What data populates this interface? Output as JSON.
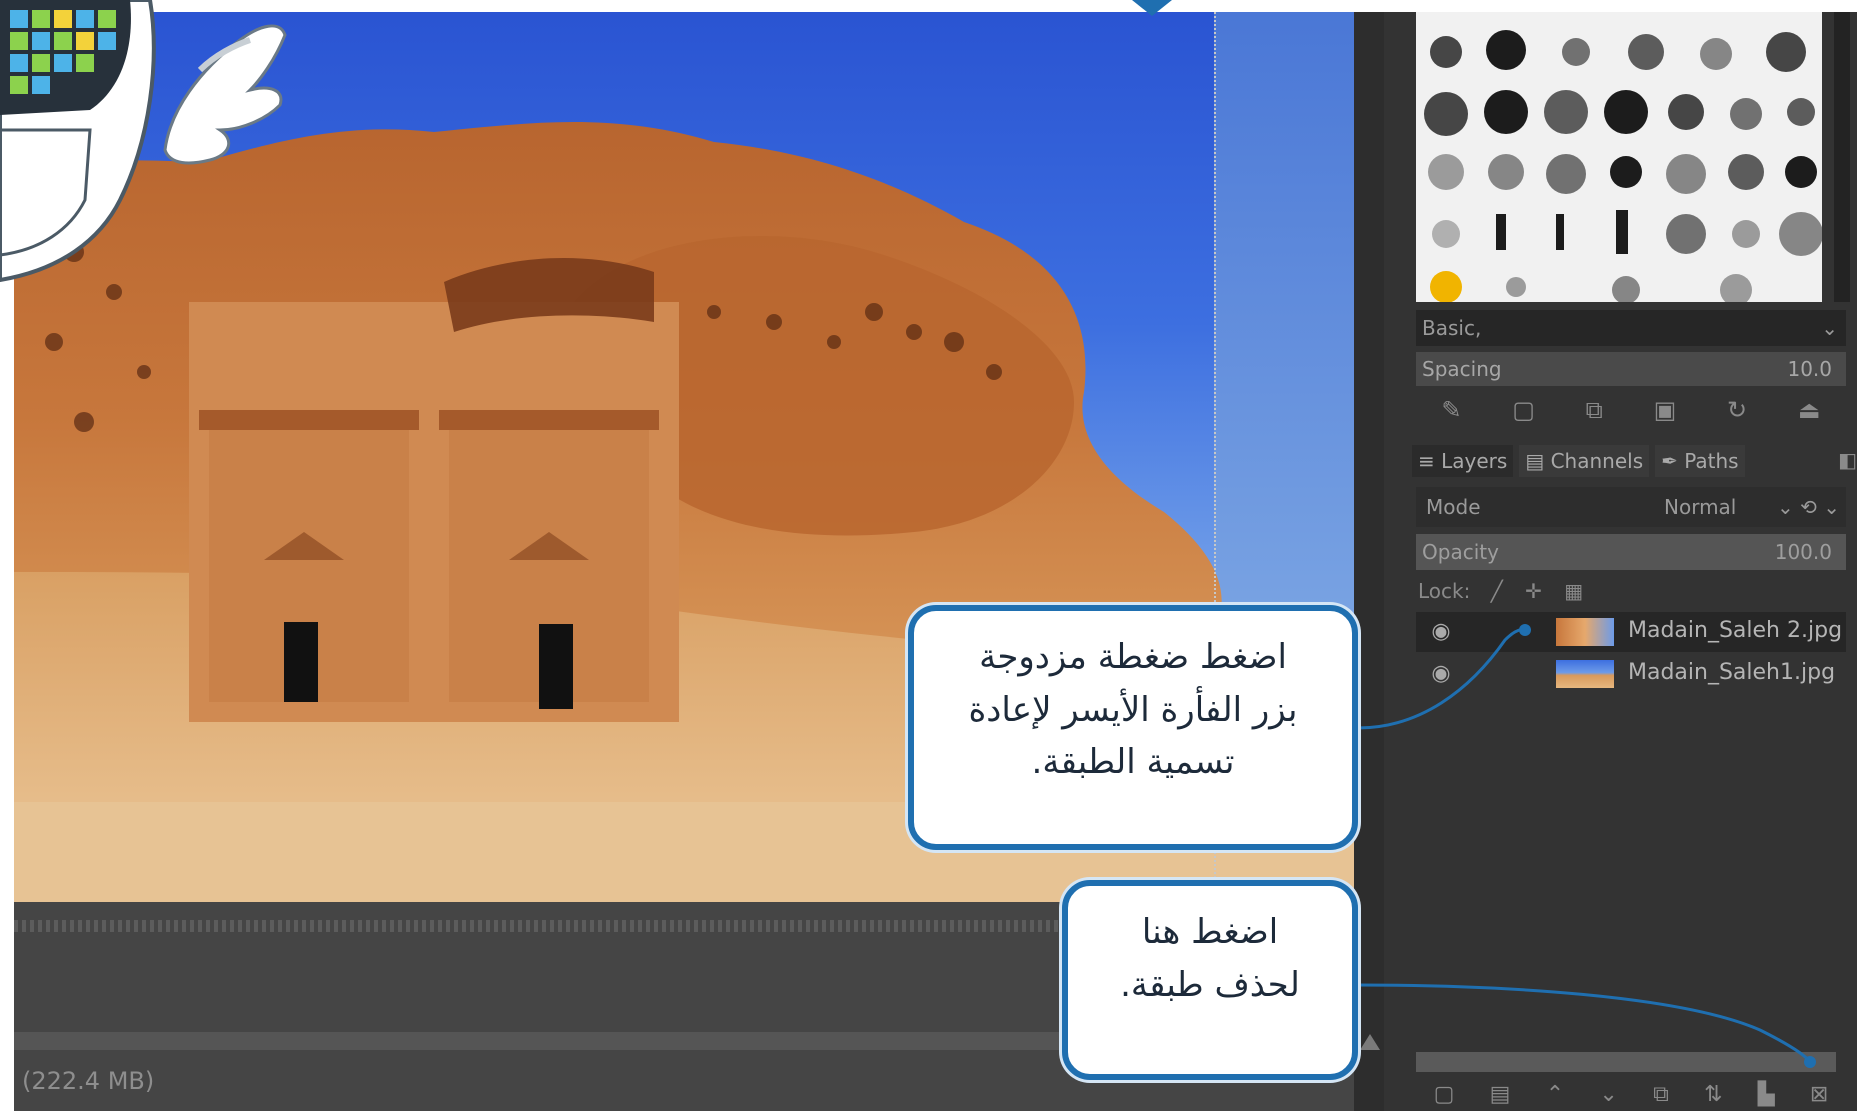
{
  "panel": {
    "brush_preset": "Basic,",
    "spacing_label": "Spacing",
    "spacing_value": "10.0"
  },
  "tabs": [
    {
      "label": "Layers",
      "icon": "layers-icon"
    },
    {
      "label": "Channels",
      "icon": "channels-icon"
    },
    {
      "label": "Paths",
      "icon": "paths-icon"
    }
  ],
  "layer_options": {
    "mode_label": "Mode",
    "mode_value": "Normal",
    "opacity_label": "Opacity",
    "opacity_value": "100.0",
    "lock_label": "Lock:"
  },
  "layers": [
    {
      "name": "Madain_Saleh 2.jpg",
      "selected": true
    },
    {
      "name": "Madain_Saleh1.jpg",
      "selected": false
    }
  ],
  "status": {
    "memory": "(222.4 MB)"
  },
  "callouts": {
    "rename": [
      "اضغط ضغطة مزدوجة",
      "بزر الفأرة الأيسر لإعادة",
      "تسمية الطبقة."
    ],
    "delete": [
      "اضغط هنا",
      "لحذف طبقة."
    ]
  },
  "colors": {
    "callout_border": "#1f6fb0",
    "panel_bg": "#333333",
    "canvas_bg": "#454545"
  }
}
